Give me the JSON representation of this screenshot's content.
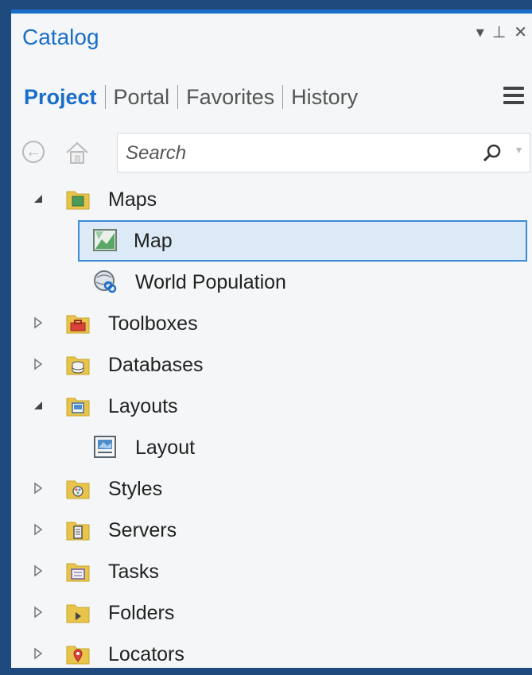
{
  "panel": {
    "title": "Catalog",
    "controls": {
      "dropdown": "▾",
      "pin": "⊥",
      "close": "✕"
    }
  },
  "tabs": [
    {
      "label": "Project",
      "active": true
    },
    {
      "label": "Portal",
      "active": false
    },
    {
      "label": "Favorites",
      "active": false
    },
    {
      "label": "History",
      "active": false
    }
  ],
  "search": {
    "placeholder": "Search",
    "value": ""
  },
  "tree": {
    "maps": {
      "label": "Maps",
      "expanded": true
    },
    "map": {
      "label": "Map",
      "selected": true
    },
    "world_population": {
      "label": "World Population"
    },
    "toolboxes": {
      "label": "Toolboxes",
      "expanded": false
    },
    "databases": {
      "label": "Databases",
      "expanded": false
    },
    "layouts": {
      "label": "Layouts",
      "expanded": true
    },
    "layout": {
      "label": "Layout"
    },
    "styles": {
      "label": "Styles",
      "expanded": false
    },
    "servers": {
      "label": "Servers",
      "expanded": false
    },
    "tasks": {
      "label": "Tasks",
      "expanded": false
    },
    "folders": {
      "label": "Folders",
      "expanded": false
    },
    "locators": {
      "label": "Locators",
      "expanded": false
    }
  },
  "colors": {
    "accent": "#1a6ec9",
    "folder": "#e8c54a",
    "selection": "#dceaf7"
  }
}
